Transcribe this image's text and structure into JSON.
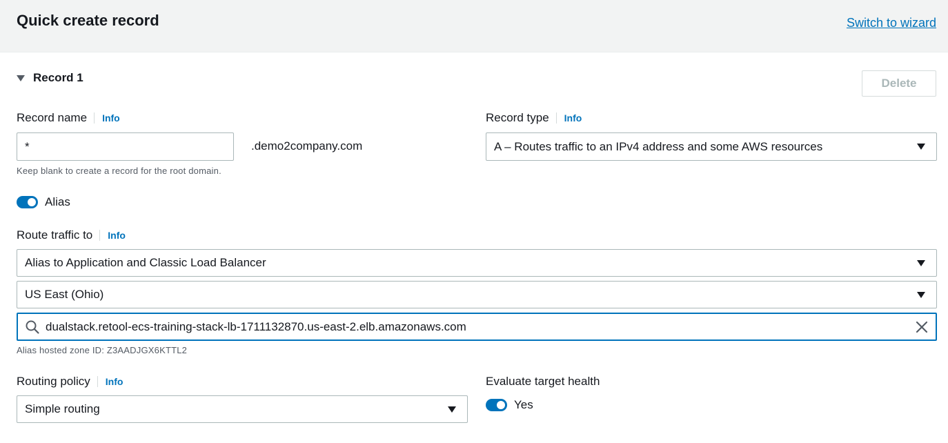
{
  "header": {
    "title": "Quick create record",
    "switch_link": "Switch to wizard"
  },
  "record": {
    "title": "Record 1",
    "delete_label": "Delete"
  },
  "record_name": {
    "label": "Record name",
    "info": "Info",
    "value": "*",
    "suffix": ".demo2company.com",
    "hint": "Keep blank to create a record for the root domain."
  },
  "record_type": {
    "label": "Record type",
    "info": "Info",
    "value": "A – Routes traffic to an IPv4 address and some AWS resources"
  },
  "alias": {
    "label": "Alias",
    "enabled": true
  },
  "route_traffic": {
    "label": "Route traffic to",
    "info": "Info",
    "endpoint": "Alias to Application and Classic Load Balancer",
    "region": "US East (Ohio)",
    "target": "dualstack.retool-ecs-training-stack-lb-1711132870.us-east-2.elb.amazonaws.com",
    "hosted_zone": "Alias hosted zone ID: Z3AADJGX6KTTL2"
  },
  "routing_policy": {
    "label": "Routing policy",
    "info": "Info",
    "value": "Simple routing"
  },
  "evaluate_health": {
    "label": "Evaluate target health",
    "toggle_label": "Yes",
    "enabled": true
  },
  "colors": {
    "accent": "#0073bb",
    "header_bg": "#f2f3f3",
    "border": "#aab7b8"
  },
  "icons": {
    "record_caret": "caret-down-icon",
    "dropdown": "chevron-down-icon",
    "search": "search-icon",
    "clear": "close-icon"
  }
}
